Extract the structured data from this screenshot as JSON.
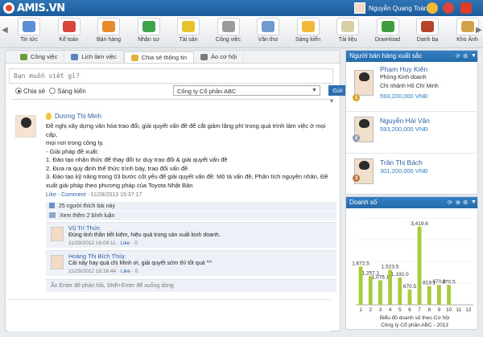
{
  "app": {
    "logo_text": "AMIS.VN"
  },
  "user": {
    "name": "Nguyễn Quang Toàn"
  },
  "toolbar": {
    "items": [
      {
        "label": "Tin tức",
        "color": "#5b8fd6"
      },
      {
        "label": "Kế toán",
        "color": "#d9473b"
      },
      {
        "label": "Bán hàng",
        "color": "#e88b2c"
      },
      {
        "label": "Nhân sự",
        "color": "#3ea44c"
      },
      {
        "label": "Tài sản",
        "color": "#e8c22c"
      },
      {
        "label": "Công việc",
        "color": "#9c9c9c"
      },
      {
        "label": "Văn thư",
        "color": "#6f9bcf"
      },
      {
        "label": "Sáng kiến",
        "color": "#f0b93a"
      },
      {
        "label": "Tài liệu",
        "color": "#d8d0a4"
      },
      {
        "label": "Download",
        "color": "#3f9c3f"
      },
      {
        "label": "Danh bạ",
        "color": "#b5442f"
      },
      {
        "label": "Kho Ảnh",
        "color": "#d2a24a"
      }
    ]
  },
  "tabs": [
    {
      "label": "Công việc",
      "color": "#6a9e3c"
    },
    {
      "label": "Lịch làm việc",
      "color": "#5f82b8"
    },
    {
      "label": "Chia sẻ thông tin",
      "color": "#e0b23c"
    },
    {
      "label": "Ảo cơ hội",
      "color": "#7a7a7a"
    }
  ],
  "composer": {
    "placeholder": "Bạn muốn viết gì?",
    "option_share": "Chia sẻ",
    "option_idea": "Sáng kiến",
    "company": "Công ty Cổ phần ABC",
    "send_label": "Gửi"
  },
  "post": {
    "author": "Dương Thị Minh",
    "lines": [
      "Đề nghị xây dựng văn hóa trao đổi, giải quyết vấn đề để cắt giảm lãng phí trong quá trình làm việc ở mọi cấp,",
      "mọi nơi trong công ty.",
      "- Giải pháp đề xuất:",
      "1. Đào tạo nhận thức để thay đổi tư duy trao đổi & giải quyết vấn đề",
      "2. Đưa ra quy định thể thức trình bày, trao đổi vấn đề",
      "3. Đào tạo kỹ năng trong 03 bước cốt yếu để giải quyết vấn đề: Mô tả vấn đề, Phân tích nguyên nhân, Đề",
      "xuất giải pháp theo phương pháp của Toyota Nhật Bản"
    ],
    "like_link": "Like",
    "comment_link": "Comment",
    "timestamp": "11/28/2013 15:37:17",
    "likes_text": "25 người thích bài này",
    "more_comments": "Xem thêm 2 bình luận"
  },
  "comments": [
    {
      "author": "Vũ Trí Thức",
      "text": "Đúng tinh thần tiết kiệm, hiệu quả trong sản xuất kinh doanh.",
      "time": "11/29/2012 16:09:11",
      "like": "Like",
      "count": "0"
    },
    {
      "author": "Hoàng Thị Bích Thủy",
      "text": "Cái này hay quá chị Minh ơi, giải quyết sớm thì tốt quá ^^",
      "time": "11/29/2012 18:16:44",
      "like": "Like",
      "count": "0"
    }
  ],
  "reply_hint": "Ấn Enter để phản hồi, Shift+Enter để xuống dòng",
  "sellers_panel": {
    "title": "Người bán hàng xuất sắc",
    "sellers": [
      {
        "rank": "1",
        "name": "Phạm Huy Kiên",
        "dept": "Phòng Kinh doanh",
        "branch": "Chi nhánh Hồ Chí Minh",
        "amount": "593,200,000 VNĐ",
        "medal_color": "#d8a22a"
      },
      {
        "rank": "2",
        "name": "Nguyễn Hải Vân",
        "dept": "",
        "branch": "",
        "amount": "593,200,000 VNĐ",
        "medal_color": "#8a9aae"
      },
      {
        "rank": "3",
        "name": "Trần Thị Bách",
        "dept": "",
        "branch": "",
        "amount": "301,200,000 VNĐ",
        "medal_color": "#b5723a"
      }
    ]
  },
  "revenue_panel": {
    "title": "Doanh số"
  },
  "chart_data": {
    "type": "bar",
    "categories": [
      "1",
      "2",
      "3",
      "4",
      "5",
      "6",
      "7",
      "8",
      "9",
      "10",
      "11",
      "12"
    ],
    "values": [
      1672.5,
      1257.1,
      1076.1,
      1523.5,
      1192.0,
      670.5,
      3419.6,
      819.1,
      870.9,
      870.5,
      null,
      null
    ],
    "value_labels": [
      "1,672.5",
      "1,257.1",
      "1,076.1",
      "1,523.5",
      "1,192.0",
      "670.5",
      "3,419.6",
      "819.1",
      "870.9",
      "870.5",
      "",
      ""
    ],
    "title": "Biểu đồ doanh số theo Cơ hội",
    "subtitle": "Công ty Cổ phần ABC - 2013",
    "ylim": [
      0,
      3800
    ],
    "bar_color": "#a6cc3c",
    "grid": true
  }
}
